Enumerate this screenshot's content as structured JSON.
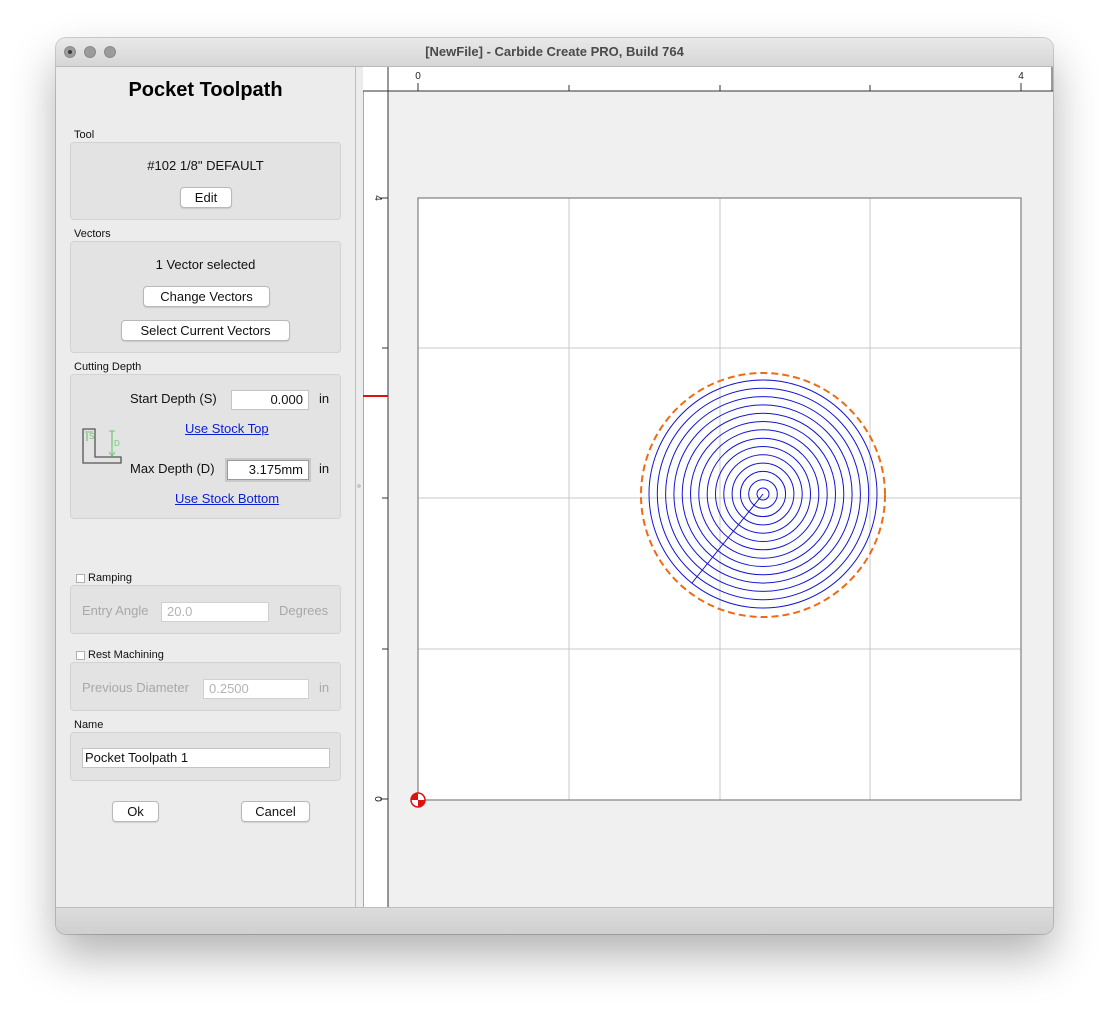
{
  "window": {
    "title": "[NewFile] - Carbide Create PRO, Build 764"
  },
  "panel": {
    "title": "Pocket Toolpath",
    "tool": {
      "section_label": "Tool",
      "name": "#102 1/8\" DEFAULT",
      "edit_label": "Edit"
    },
    "vectors": {
      "section_label": "Vectors",
      "status": "1 Vector selected",
      "change_label": "Change Vectors",
      "select_current_label": "Select Current Vectors"
    },
    "cutting_depth": {
      "section_label": "Cutting Depth",
      "start_label": "Start Depth (S)",
      "start_value": "0.000",
      "start_unit": "in",
      "use_stock_top": "Use Stock Top",
      "max_label": "Max Depth (D)",
      "max_value": "3.175mm",
      "max_unit": "in",
      "use_stock_bottom": "Use Stock Bottom",
      "diagram_s": "S",
      "diagram_d": "D"
    },
    "ramping": {
      "label": "Ramping",
      "checked": false,
      "entry_angle_label": "Entry Angle",
      "entry_angle_value": "20.0",
      "unit": "Degrees"
    },
    "rest_machining": {
      "label": "Rest Machining",
      "checked": false,
      "prev_diameter_label": "Previous Diameter",
      "prev_diameter_value": "0.2500",
      "unit": "in"
    },
    "name": {
      "section_label": "Name",
      "value": "Pocket Toolpath 1"
    },
    "ok_label": "Ok",
    "cancel_label": "Cancel"
  },
  "canvas": {
    "ruler_top_labels": [
      "0",
      "4"
    ],
    "ruler_left_labels": [
      "4",
      "0"
    ],
    "grid_divisions": 4,
    "spiral_rings": 14,
    "colors": {
      "toolpath": "#1414d2",
      "outline": "#f06a14",
      "origin": "#e01010",
      "grid": "#c8c8c8",
      "stock_border": "#808080"
    }
  }
}
